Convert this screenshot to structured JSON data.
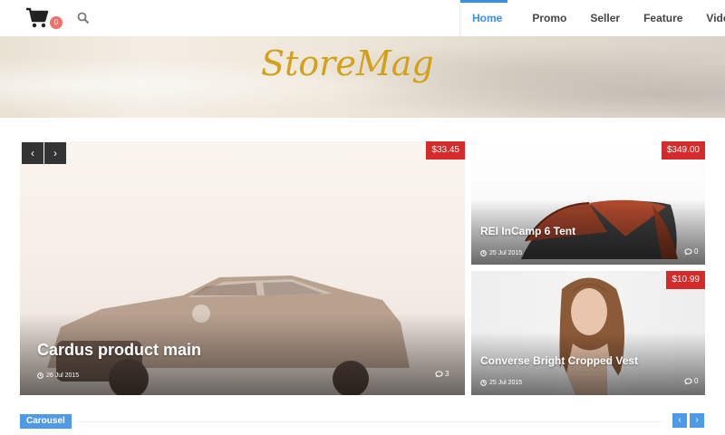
{
  "header": {
    "cart_count": "0",
    "nav": [
      "Home",
      "Promo",
      "Seller",
      "Feature",
      "Video"
    ]
  },
  "banner": {
    "logo_text": "StoreMag"
  },
  "slider": {
    "prev": "‹",
    "next": "›"
  },
  "cards": {
    "main": {
      "price": "$33.45",
      "title": "Cardus product main",
      "date": "26 Jul 2015",
      "comments": "3"
    },
    "tent": {
      "price": "$349.00",
      "title": "REI InCamp 6 Tent",
      "date": "25 Jul 2015",
      "comments": "0"
    },
    "vest": {
      "price": "$10.99",
      "title": "Converse Bright Cropped Vest",
      "date": "25 Jul 2015",
      "comments": "0"
    }
  },
  "carousel": {
    "label": "Carousel",
    "prev": "‹",
    "next": "›"
  },
  "colors": {
    "accent": "#3a8ee6",
    "price_bg": "#d42a2a",
    "badge": "#f2726b"
  }
}
